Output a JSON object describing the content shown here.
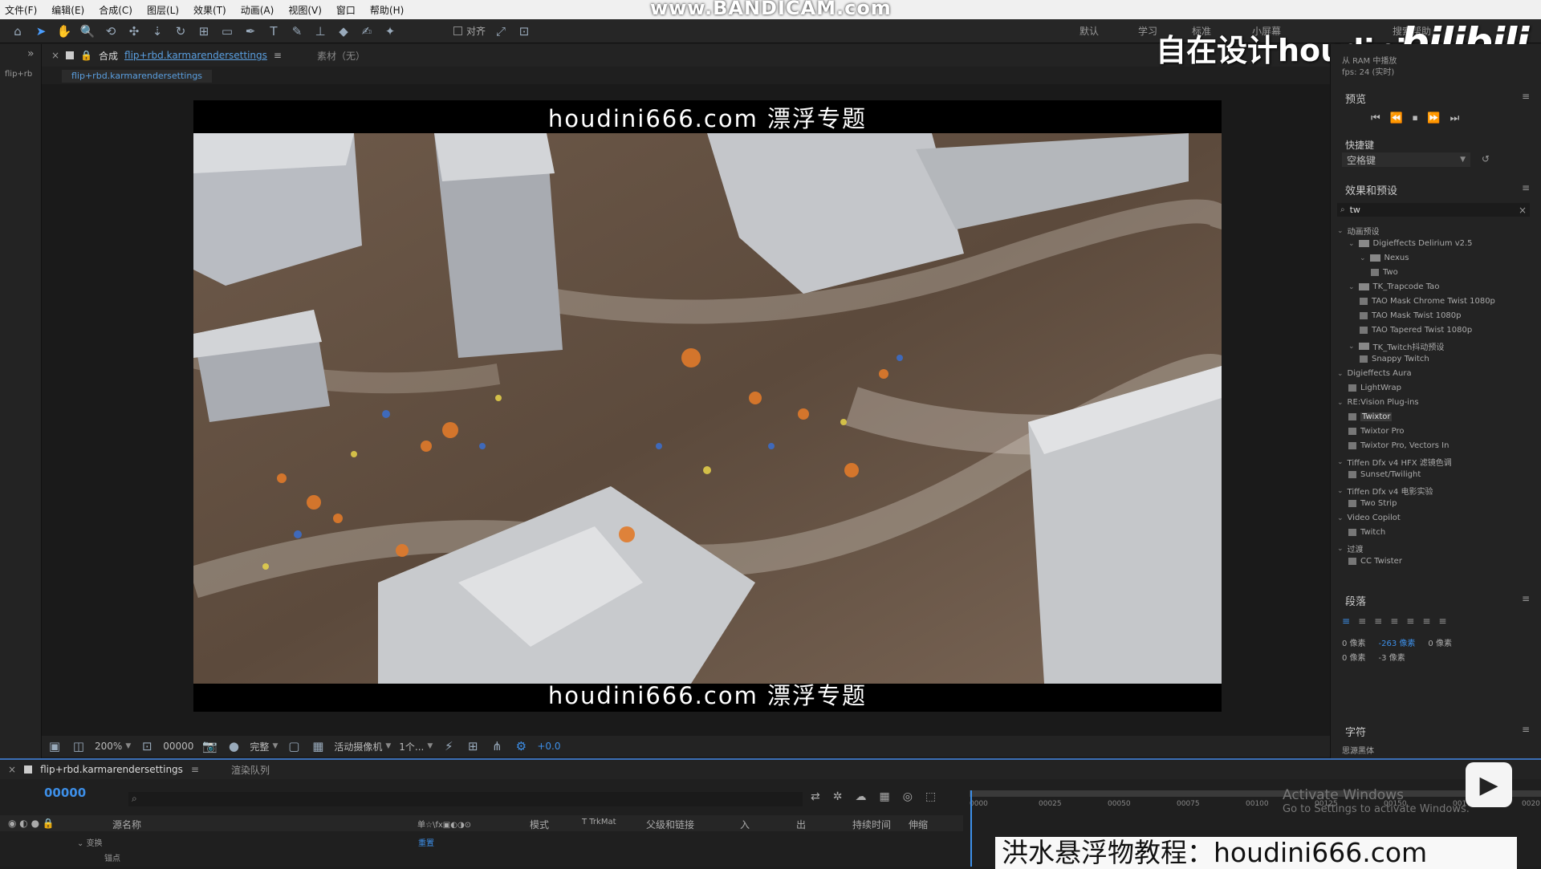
{
  "menu": [
    "文件(F)",
    "编辑(E)",
    "合成(C)",
    "图层(L)",
    "效果(T)",
    "动画(A)",
    "视图(V)",
    "窗口",
    "帮助(H)"
  ],
  "watermark_top": "www.BANDICAM.com",
  "toolbar": {
    "snap_label": "对齐",
    "workspaces": [
      "默认",
      "学习",
      "标准",
      "小屏幕"
    ],
    "workspace_active": "搜索帮助"
  },
  "overlay": {
    "brand_title": "自在设计houdini",
    "bili": "bilibili",
    "ram_info": "从 RAM 中播放",
    "fps_info": "fps: 24 (实时)",
    "bottom_banner": "洪水悬浮物教程：houdini666.com",
    "activate_line1": "Activate Windows",
    "activate_line2": "Go to Settings to activate Windows."
  },
  "left_rail": {
    "label": "flip+rb"
  },
  "comp_panel": {
    "tab_prefix": "合成",
    "tab_name": "flip+rbd.karmarendersettings",
    "footage_label": "素材（无）",
    "breadcrumb": "flip+rbd.karmarendersettings"
  },
  "viewer": {
    "subtitle_top": "houdini666.com 漂浮专题",
    "subtitle_bottom": "houdini666.com 漂浮专题"
  },
  "viewer_footer": {
    "zoom": "200%",
    "timecode": "00000",
    "resolution": "完整",
    "camera": "活动摄像机",
    "views": "1个...",
    "exposure": "+0.0"
  },
  "right_panel": {
    "preview_title": "预览",
    "shortcut_label": "快捷键",
    "shortcut_value": "空格键",
    "effects_title": "效果和预设",
    "search_value": "tw",
    "tree": [
      {
        "label": "动画预设",
        "indent": 0,
        "kind": "arrow"
      },
      {
        "label": "Digieffects Delirium v2.5",
        "indent": 1,
        "kind": "folder"
      },
      {
        "label": "Nexus",
        "indent": 2,
        "kind": "folder"
      },
      {
        "label": "Two",
        "indent": 3,
        "kind": "item"
      },
      {
        "label": "TK_Trapcode Tao",
        "indent": 1,
        "kind": "folder"
      },
      {
        "label": "TAO Mask Chrome Twist 1080p",
        "indent": 2,
        "kind": "item"
      },
      {
        "label": "TAO Mask Twist 1080p",
        "indent": 2,
        "kind": "item"
      },
      {
        "label": "TAO Tapered Twist 1080p",
        "indent": 2,
        "kind": "item"
      },
      {
        "label": "TK_Twitch抖动预设",
        "indent": 1,
        "kind": "folder"
      },
      {
        "label": "Snappy Twitch",
        "indent": 2,
        "kind": "item"
      },
      {
        "label": "Digieffects Aura",
        "indent": 0,
        "kind": "arrow"
      },
      {
        "label": "LightWrap",
        "indent": 1,
        "kind": "item"
      },
      {
        "label": "RE:Vision Plug-ins",
        "indent": 0,
        "kind": "arrow"
      },
      {
        "label": "Twixtor",
        "indent": 1,
        "kind": "item",
        "selected": true
      },
      {
        "label": "Twixtor Pro",
        "indent": 1,
        "kind": "item"
      },
      {
        "label": "Twixtor Pro, Vectors In",
        "indent": 1,
        "kind": "item"
      },
      {
        "label": "Tiffen Dfx v4 HFX 滤镜色调",
        "indent": 0,
        "kind": "arrow"
      },
      {
        "label": "Sunset/Twilight",
        "indent": 1,
        "kind": "item"
      },
      {
        "label": "Tiffen Dfx v4 电影实验",
        "indent": 0,
        "kind": "arrow"
      },
      {
        "label": "Two Strip",
        "indent": 1,
        "kind": "item"
      },
      {
        "label": "Video Copilot",
        "indent": 0,
        "kind": "arrow"
      },
      {
        "label": "Twitch",
        "indent": 1,
        "kind": "item"
      },
      {
        "label": "过渡",
        "indent": 0,
        "kind": "arrow"
      },
      {
        "label": "CC Twister",
        "indent": 1,
        "kind": "item"
      }
    ],
    "paragraph_title": "段落",
    "para_values": [
      "0 像素",
      "-263 像素",
      "0 像素",
      "0 像素",
      "-3 像素"
    ],
    "character_title": "字符",
    "character_font": "思源黑体"
  },
  "timeline": {
    "tab_name": "flip+rbd.karmarendersettings",
    "render_queue": "渲染队列",
    "timecode": "00000",
    "columns": [
      "源名称",
      "单☆\\fx▣◐◑⊙",
      "模式",
      "T TrkMat",
      "父级和链接",
      "入",
      "出",
      "持续时间",
      "伸缩"
    ],
    "rows": [
      {
        "label": "变换"
      },
      {
        "label": "锚点"
      }
    ],
    "reset": "重置",
    "ruler_ticks": [
      "0000",
      "00025",
      "00050",
      "00075",
      "00100",
      "00125",
      "00150",
      "00175",
      "0020"
    ]
  },
  "colors": {
    "accent": "#3d8fe8",
    "panel": "#232323",
    "viewer_bg": "#1a1a1a"
  }
}
